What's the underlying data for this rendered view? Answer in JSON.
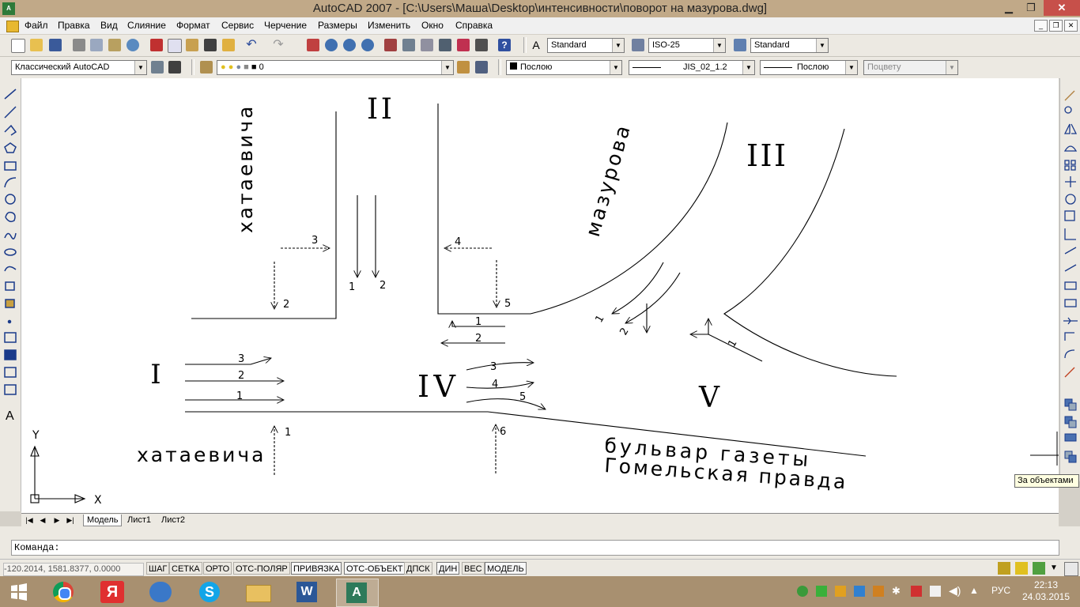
{
  "window": {
    "title": "AutoCAD 2007 - [C:\\Users\\Маша\\Desktop\\интенсивности\\поворот на мазурова.dwg]",
    "app_icon": "A",
    "minimize": "▁",
    "restore": "❐",
    "close": "✕"
  },
  "menu": {
    "items": [
      "Файл",
      "Правка",
      "Вид",
      "Слияние",
      "Формат",
      "Сервис",
      "Черчение",
      "Размеры",
      "Изменить",
      "Окно",
      "Справка"
    ],
    "doc_min": "_",
    "doc_restore": "❐",
    "doc_close": "✕"
  },
  "toolbar1": {
    "text_style": "Standard",
    "dim_style": "ISO-25",
    "table_style": "Standard"
  },
  "toolbar2": {
    "workspace": "Классический AutoCAD",
    "layer": "0",
    "color": "Послою",
    "linetype": "JIS_02_1.2",
    "lineweight": "Послою",
    "plotstyle": "Поцвету"
  },
  "drawing": {
    "roman_1": "I",
    "roman_2": "II",
    "roman_3": "III",
    "roman_4": "IV",
    "roman_5": "V",
    "street_khataevicha_vertical": "хатаевича",
    "street_khataevicha_horizontal": "хатаевича",
    "street_mazurova": "мазурова",
    "boulevard_line1": "бульвар газеты",
    "boulevard_line2": "Гомельская правда",
    "ucs_y": "Y",
    "ucs_x": "X",
    "labels": {
      "ii_1": "1",
      "ii_2": "2",
      "ii_3": "3",
      "ii_4": "4",
      "ii_5": "5",
      "ii_dash2": "2",
      "iv_w1": "1",
      "iv_w2": "2",
      "i_3": "3",
      "i_2": "2",
      "i_1": "1",
      "i_up1": "1",
      "iv_3": "3",
      "iv_4": "4",
      "iv_5": "5",
      "iv_up6": "6",
      "m_1": "1",
      "m_2": "2",
      "v_1": "1"
    }
  },
  "tabs": {
    "nav": [
      "|◀",
      "◀",
      "▶",
      "▶|"
    ],
    "items": [
      "Модель",
      "Лист1",
      "Лист2"
    ]
  },
  "command": {
    "prompt": "Команда:"
  },
  "status": {
    "coords": "-120.2014, 1581.8377, 0.0000",
    "buttons": [
      "ШАГ",
      "СЕТКА",
      "ОРТО",
      "ОТС-ПОЛЯР",
      "ПРИВЯЗКА",
      "ОТС-ОБЪЕКТ",
      "ДПСК",
      "ДИН",
      "ВЕС",
      "МОДЕЛЬ"
    ]
  },
  "tooltip": {
    "text": "За объектами"
  },
  "taskbar": {
    "apps": [
      "start-button",
      "chrome-icon",
      "yandex-browser-icon",
      "audio-app-icon",
      "skype-icon",
      "file-explorer-icon",
      "word-icon",
      "autocad-icon"
    ],
    "lang": "РУС",
    "time": "22:13",
    "date": "24.03.2015"
  },
  "colors": {
    "titlebar": "#c1a988",
    "taskbar": "#a89070",
    "close": "#c7504a"
  }
}
